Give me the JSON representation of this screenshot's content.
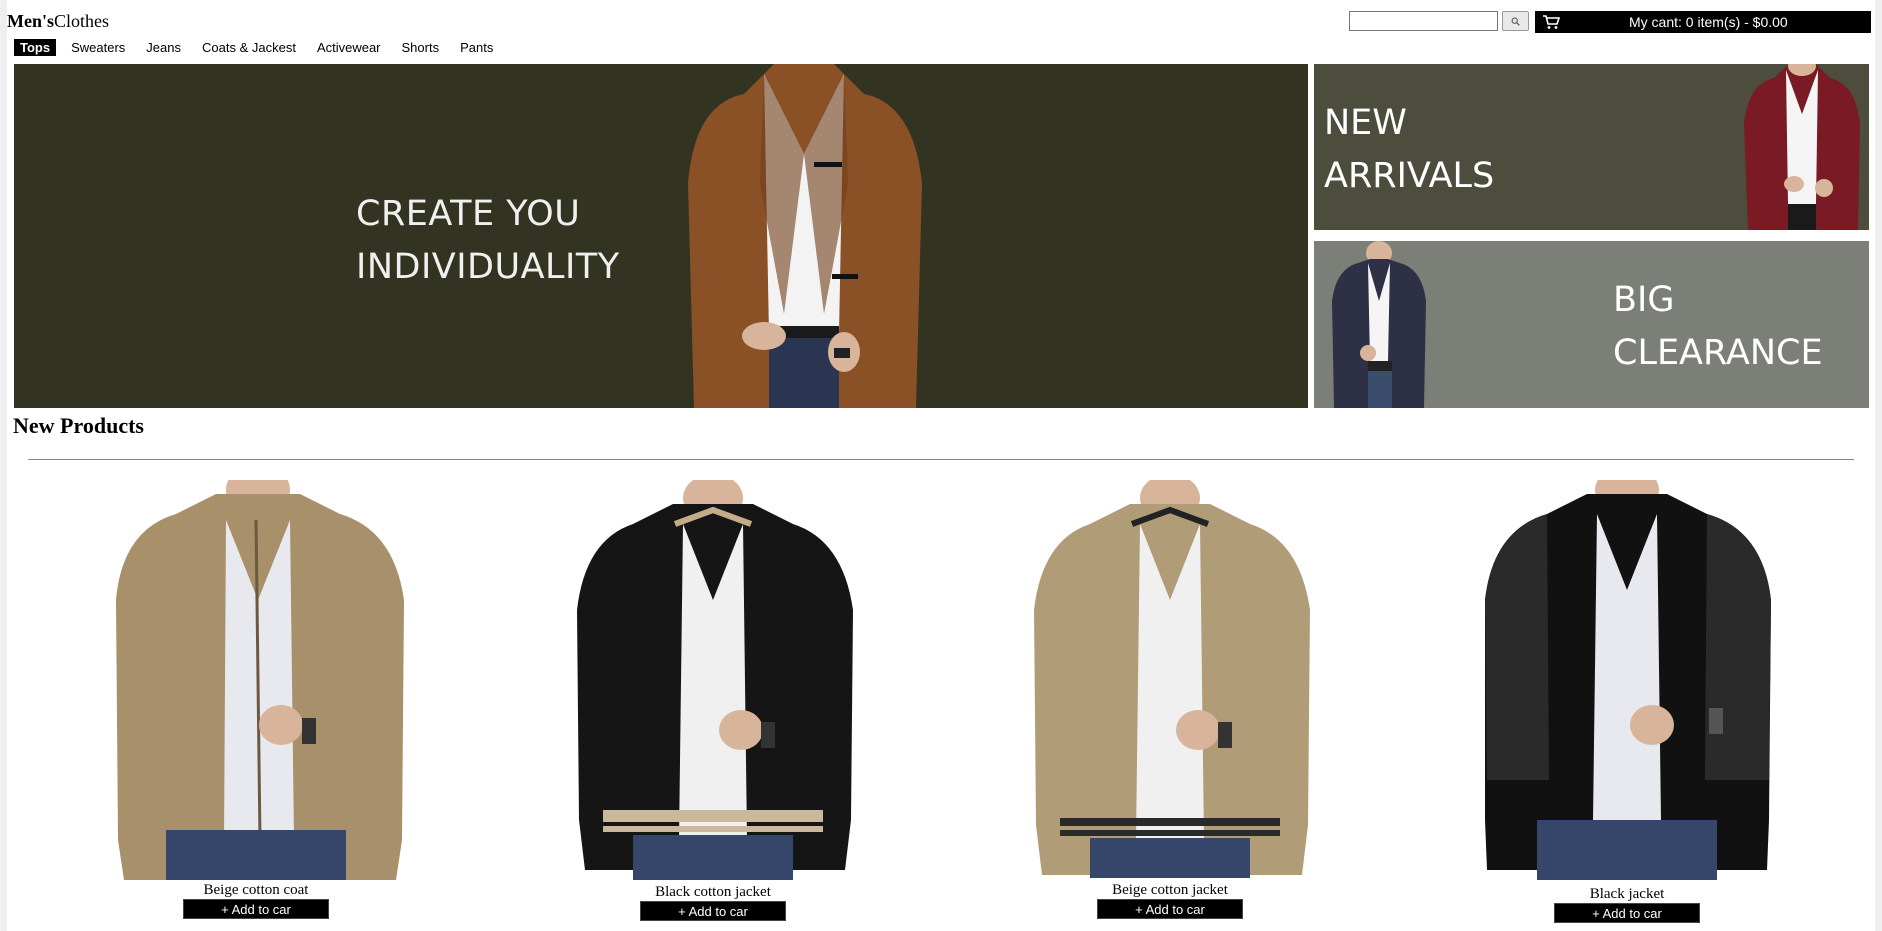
{
  "header": {
    "logo_bold": "Men's",
    "logo_rest": "Clothes",
    "search": {
      "value": "",
      "button_icon": "search-icon"
    },
    "cart": {
      "icon": "cart-icon",
      "text": "My cant: 0 item(s) - $0.00"
    }
  },
  "nav": {
    "items": [
      {
        "label": "Tops",
        "active": true
      },
      {
        "label": "Sweaters"
      },
      {
        "label": "Jeans"
      },
      {
        "label": "Coats & Jackest"
      },
      {
        "label": "Activewear"
      },
      {
        "label": "Shorts"
      },
      {
        "label": "Pants"
      }
    ]
  },
  "banners": {
    "main": {
      "line1": "CREATE YOU",
      "line2": "INDIVIDUALITY"
    },
    "new_arrivals": {
      "line1": "NEW",
      "line2": "ARRIVALS"
    },
    "clearance": {
      "line1": "BIG",
      "line2": "CLEARANCE"
    }
  },
  "products": {
    "title": "New Products",
    "items": [
      {
        "name": "Beige cotton coat",
        "button": "+ Add to car"
      },
      {
        "name": "Black cotton jacket",
        "button": "+ Add to car"
      },
      {
        "name": "Beige cotton jacket",
        "button": "+ Add to car"
      },
      {
        "name": "Black jacket",
        "button": "+ Add to car"
      }
    ]
  },
  "colors": {
    "banner_main": "#323421",
    "banner_new": "#4c4d3d",
    "banner_clearance": "#7b7f77",
    "beige": "#a8906a",
    "black": "#151515",
    "burgundy": "#7a1a25",
    "navy": "#2e3145",
    "brown": "#8a5026"
  }
}
